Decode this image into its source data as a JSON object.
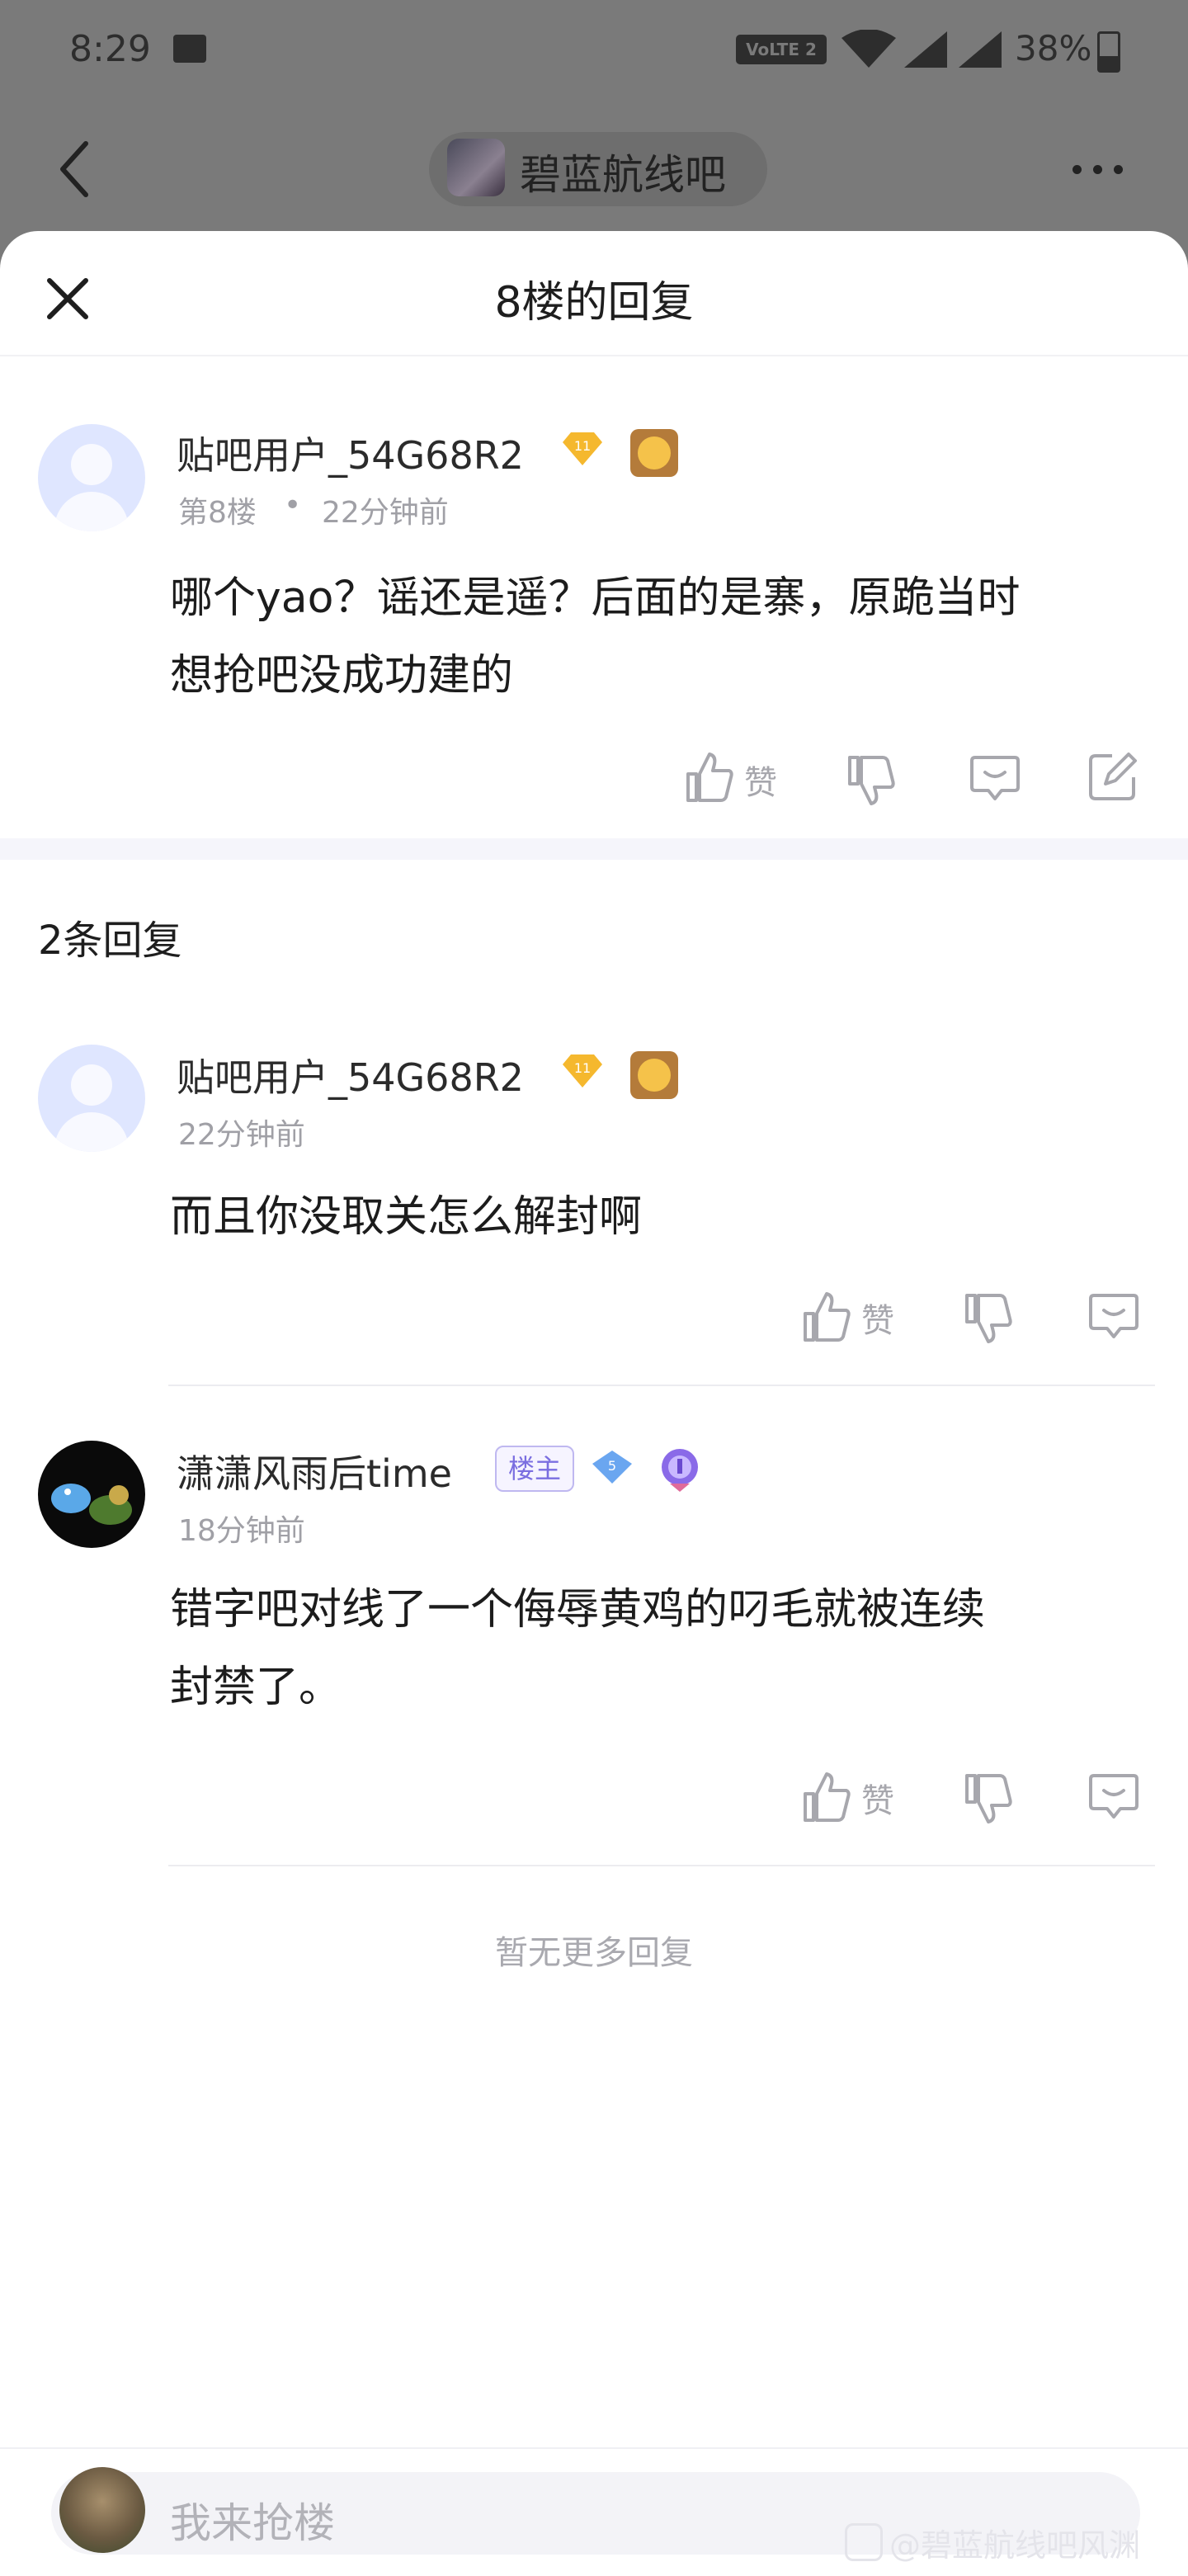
{
  "status_bar": {
    "time": "8:29",
    "network": "VoLTE 2",
    "battery": "38%",
    "battery_level": 0.38
  },
  "background_page": {
    "forum_name": "碧蓝航线吧"
  },
  "sheet": {
    "title": "8楼的回复"
  },
  "main_post": {
    "username": "贴吧用户_54G68R2",
    "level": "11",
    "floor": "第8楼",
    "dot": "•",
    "time": "22分钟前",
    "content_lines": [
      "哪个yao？谣还是遥？后面的是寨，原跪当时",
      "想抢吧没成功建的"
    ],
    "like_label": "赞"
  },
  "replies_section": {
    "title": "2条回复"
  },
  "replies": [
    {
      "username": "贴吧用户_54G68R2",
      "level": "11",
      "time": "22分钟前",
      "content_lines": [
        "而且你没取关怎么解封啊"
      ],
      "like_label": "赞"
    },
    {
      "username": "潇潇风雨后time",
      "owner_badge": "楼主",
      "level": "5",
      "time": "18分钟前",
      "content_lines": [
        "错字吧对线了一个侮辱黄鸡的叼毛就被连续",
        "封禁了。"
      ],
      "like_label": "赞"
    }
  ],
  "no_more": "暂无更多回复",
  "bottom_bar": {
    "input_placeholder": "我来抢楼"
  },
  "watermark": "@碧蓝航线吧风渊",
  "colors": {
    "accent_gold": "#f5b82e",
    "owner_badge": "#7a6ee0",
    "icon_gray": "#a7a7ad"
  }
}
